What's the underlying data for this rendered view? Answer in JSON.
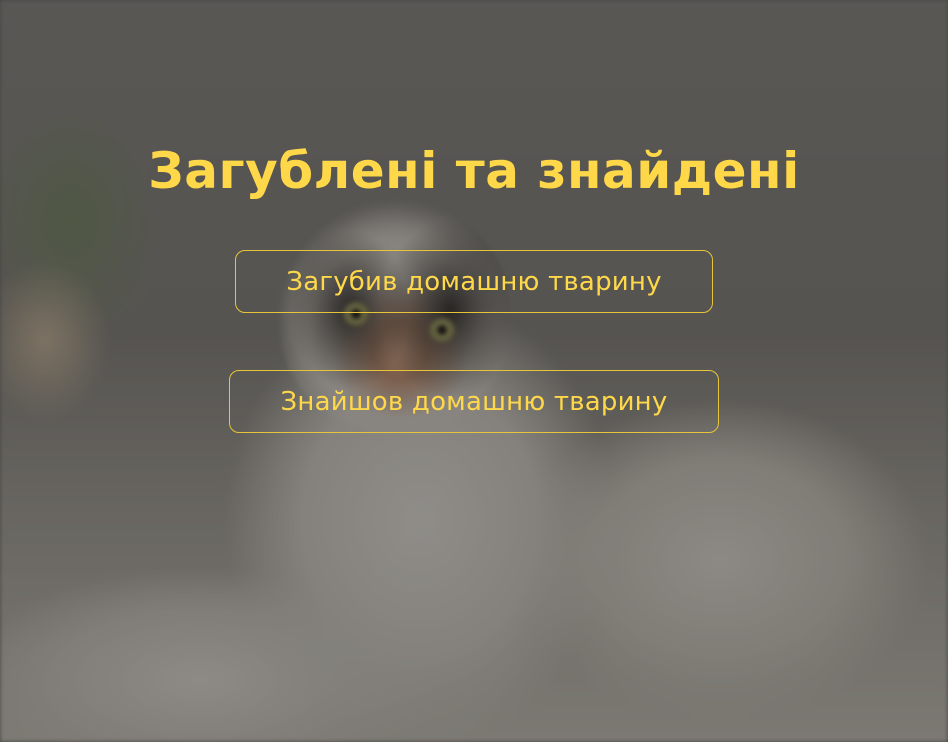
{
  "hero": {
    "title": "Загублені та знайдені",
    "lost_button_label": "Загубив домашню тварину",
    "found_button_label": "Знайшов домашню тварину",
    "background_image": "calico-cat-on-bed-photo"
  },
  "colors": {
    "accent": "#ffd84a",
    "overlay": "rgba(20,18,16,0.42)"
  }
}
